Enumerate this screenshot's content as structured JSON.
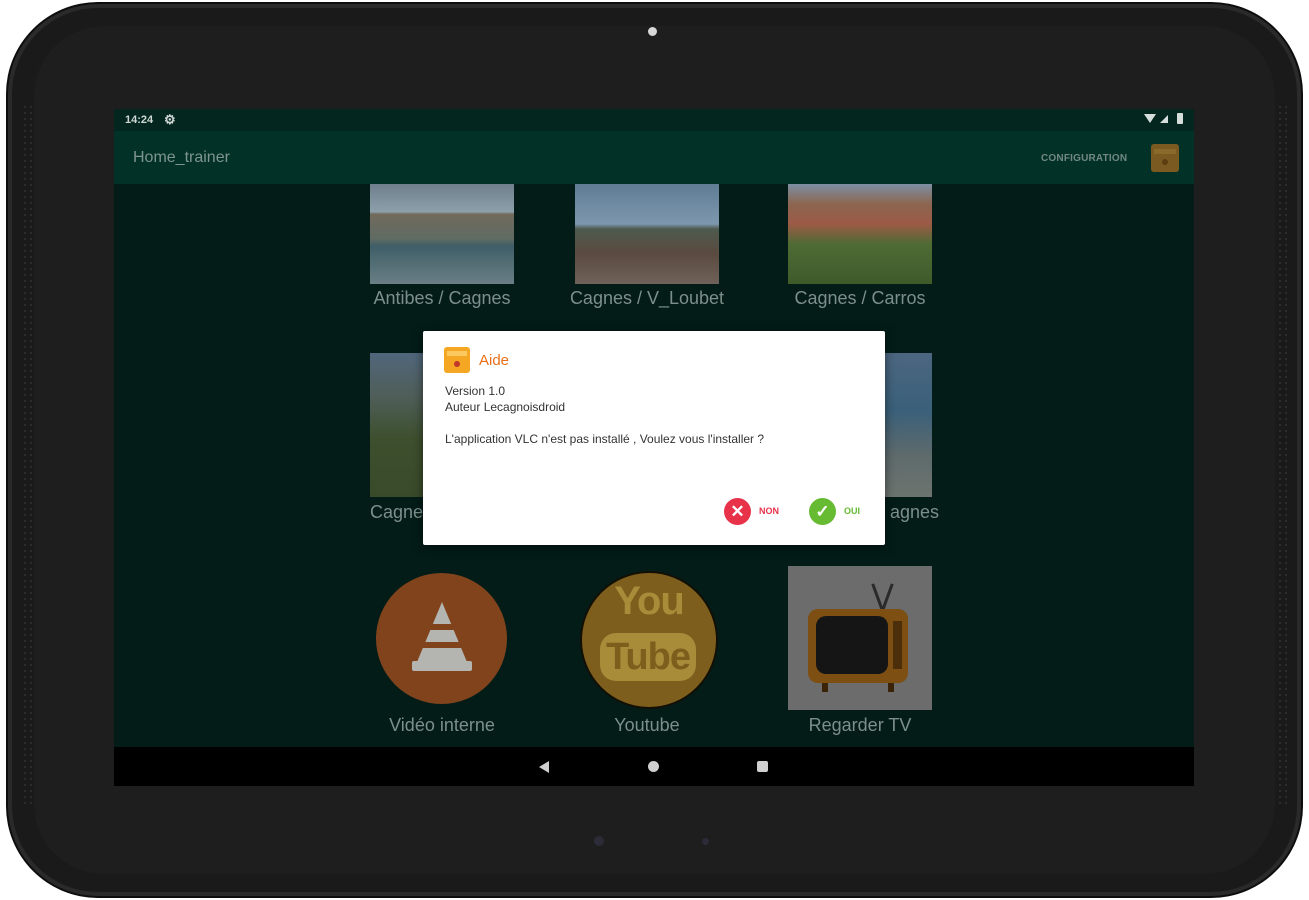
{
  "status_bar": {
    "time": "14:24",
    "settings_icon": "gear-icon",
    "wifi_icon": "wifi-icon",
    "signal_icon": "signal-icon",
    "battery_icon": "battery-icon"
  },
  "app_bar": {
    "title": "Home_trainer",
    "config_label": "CONFIGURATION",
    "icon": "app-treasure-icon"
  },
  "tiles": [
    {
      "label": "Antibes / Cagnes",
      "image": "antibes-harbor"
    },
    {
      "label": "Cagnes / V_Loubet",
      "image": "promenade-seaside"
    },
    {
      "label": "Cagnes / Carros",
      "image": "hillside-village"
    },
    {
      "label": "Cagne",
      "image": "green-hills"
    },
    {
      "label": "agnes",
      "image": "coastline"
    }
  ],
  "apps": [
    {
      "label": "Vidéo interne",
      "icon": "vlc-cone-icon"
    },
    {
      "label": "Youtube",
      "icon": "youtube-icon",
      "logo_top": "You",
      "logo_bottom": "Tube"
    },
    {
      "label": "Regarder TV",
      "icon": "tv-icon"
    }
  ],
  "dialog": {
    "title": "Aide",
    "icon": "treasure-chest-icon",
    "line1": "Version 1.0",
    "line2": "Auteur Lecagnoisdroid",
    "message": "L'application VLC n'est pas installé , Voulez vous l'installer ?",
    "no_label": "NON",
    "yes_label": "OUI",
    "no_icon": "close-icon",
    "yes_icon": "check-icon"
  },
  "nav_bar": {
    "back": "back-icon",
    "home": "home-icon",
    "recent": "recent-apps-icon"
  },
  "colors": {
    "app_bar": "#023127",
    "screen_bg": "#031c17",
    "dialog_title": "#e8701a",
    "no": "#e7324a",
    "yes": "#66bb33"
  }
}
